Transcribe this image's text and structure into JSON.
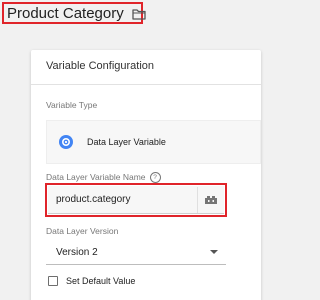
{
  "header": {
    "title": "Product Category",
    "icon": "folder-icon"
  },
  "card": {
    "title": "Variable Configuration",
    "variable_type": {
      "label": "Variable Type",
      "value": "Data Layer Variable",
      "icon": "gear-icon",
      "icon_color": "#4285f4"
    },
    "variable_name": {
      "label": "Data Layer Variable Name",
      "value": "product.category",
      "help_icon": "help-icon",
      "picker_icon": "variable-picker-icon"
    },
    "version": {
      "label": "Data Layer Version",
      "value": "Version 2"
    },
    "default_value": {
      "label": "Set Default Value",
      "checked": false
    }
  },
  "colors": {
    "highlight": "#e0242a",
    "background": "#f1f1f1",
    "accent": "#4285f4"
  }
}
